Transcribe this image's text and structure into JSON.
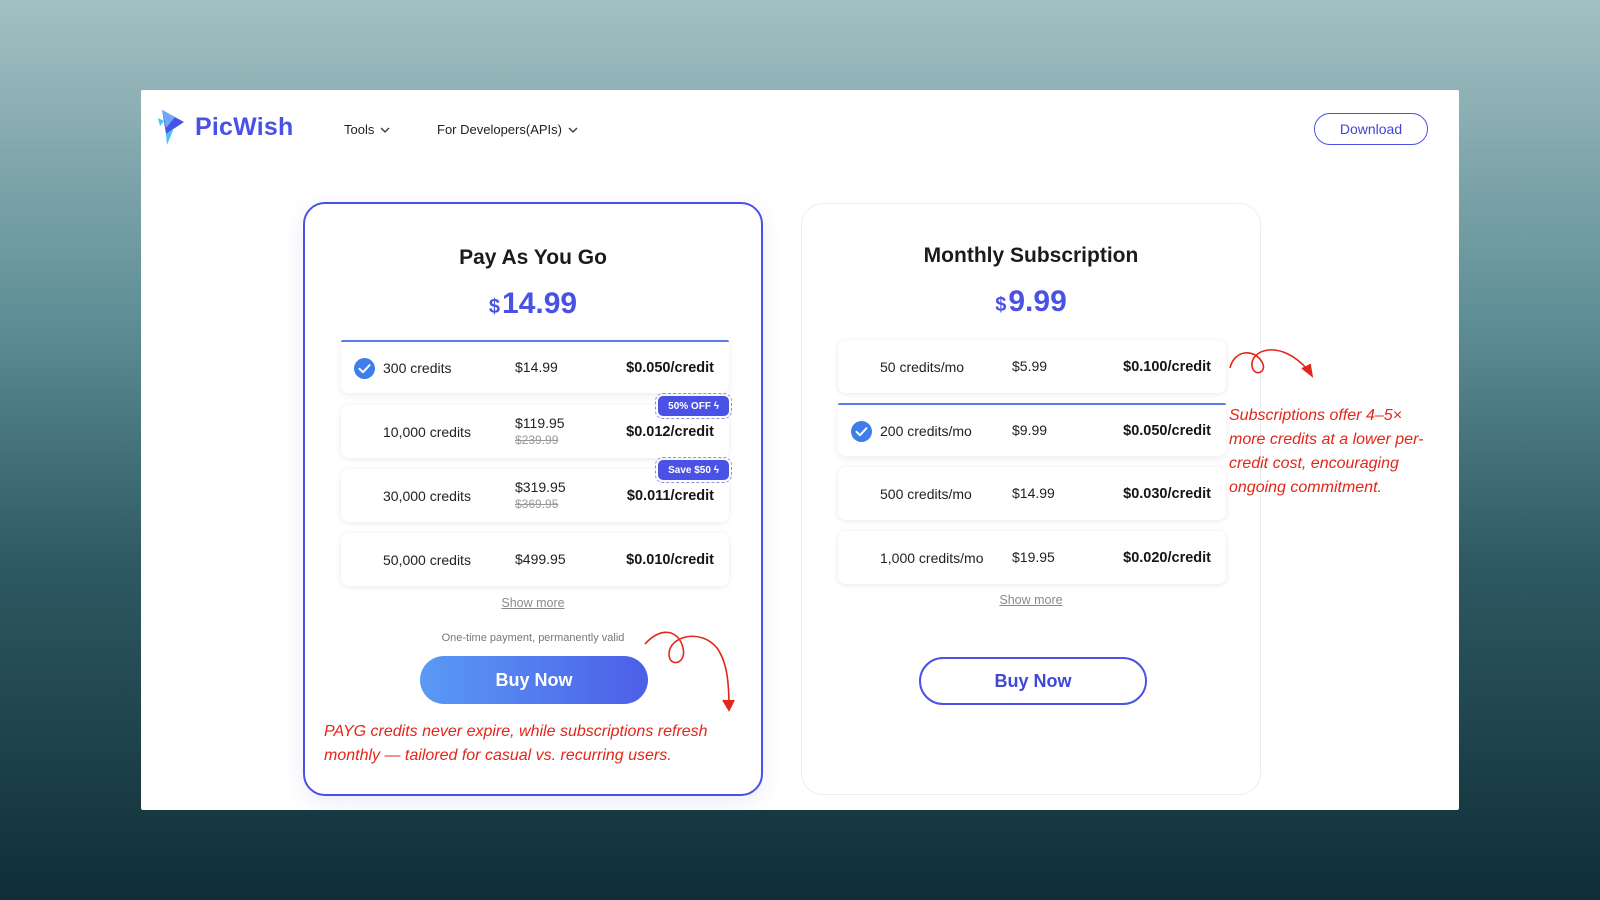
{
  "header": {
    "brand": "PicWish",
    "nav": [
      {
        "label": "Tools"
      },
      {
        "label": "For Developers(APIs)"
      }
    ],
    "download_label": "Download"
  },
  "payg": {
    "title": "Pay As You Go",
    "currency": "$",
    "price": "14.99",
    "rows": [
      {
        "credits": "300 credits",
        "price": "$14.99",
        "old_price": "",
        "per_credit": "$0.050/credit",
        "badge": "",
        "selected": true
      },
      {
        "credits": "10,000 credits",
        "price": "$119.95",
        "old_price": "$239.99",
        "per_credit": "$0.012/credit",
        "badge": "50% OFF ϟ",
        "selected": false
      },
      {
        "credits": "30,000 credits",
        "price": "$319.95",
        "old_price": "$369.95",
        "per_credit": "$0.011/credit",
        "badge": "Save $50 ϟ",
        "selected": false
      },
      {
        "credits": "50,000 credits",
        "price": "$499.95",
        "old_price": "",
        "per_credit": "$0.010/credit",
        "badge": "",
        "selected": false
      }
    ],
    "show_more": "Show more",
    "note": "One-time payment, permanently valid",
    "buy_label": "Buy Now"
  },
  "subscription": {
    "title": "Monthly Subscription",
    "currency": "$",
    "price": "9.99",
    "rows": [
      {
        "credits": "50 credits/mo",
        "price": "$5.99",
        "per_credit": "$0.100/credit",
        "selected": false
      },
      {
        "credits": "200 credits/mo",
        "price": "$9.99",
        "per_credit": "$0.050/credit",
        "selected": true
      },
      {
        "credits": "500 credits/mo",
        "price": "$14.99",
        "per_credit": "$0.030/credit",
        "selected": false
      },
      {
        "credits": "1,000 credits/mo",
        "price": "$19.95",
        "per_credit": "$0.020/credit",
        "selected": false
      }
    ],
    "show_more": "Show more",
    "buy_label": "Buy Now"
  },
  "annotations": {
    "payg_line1": "PAYG credits never expire, while subscriptions refresh",
    "payg_line2": "monthly — tailored for casual vs. recurring users.",
    "sub_line1": "Subscriptions offer 4–5×",
    "sub_line2": "more credits at a lower per-",
    "sub_line3": "credit cost, encouraging",
    "sub_line4": "ongoing commitment."
  },
  "colors": {
    "brand": "#4a52e6",
    "annotation": "#e3261a",
    "check": "#3f7ee8"
  },
  "icons": {
    "logo": "picwish-logo-icon",
    "nav_chevron": "chevron-down-icon",
    "selected": "check-circle-icon",
    "arrow": "curved-arrow-icon"
  }
}
